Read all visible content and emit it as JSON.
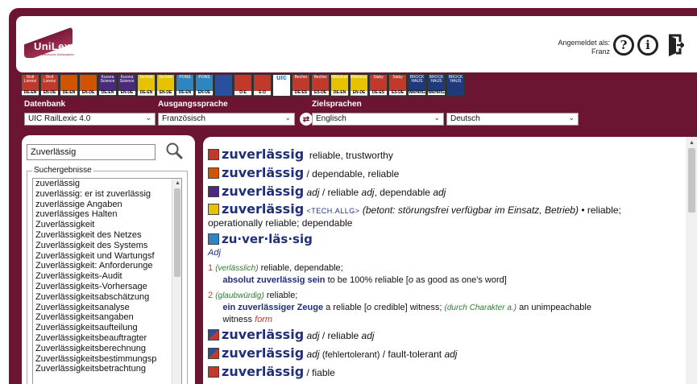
{
  "header": {
    "logo_name": "UniLex",
    "logo_sub": "Electronic Dictionaries",
    "login_label": "Angemeldet als:",
    "login_user": "Franz"
  },
  "dictionaries": [
    {
      "top": "Dictl Lorenz",
      "bot": "DE-EN",
      "color": "#c0392b"
    },
    {
      "top": "Dictl Lorenz",
      "bot": "EN-DE",
      "color": "#c0392b"
    },
    {
      "top": "",
      "bot": "DE-EN",
      "color": "#d35400"
    },
    {
      "top": "",
      "bot": "EN-DE",
      "color": "#d35400"
    },
    {
      "top": "Kucera Science",
      "bot": "DE-EN",
      "color": "#4a2a7a"
    },
    {
      "top": "Kucera Science",
      "bot": "EN-DE",
      "color": "#4a2a7a"
    },
    {
      "top": "Technik",
      "bot": "DE-EN",
      "color": "#e6c200"
    },
    {
      "top": "Technik",
      "bot": "EN-DE",
      "color": "#e6c200"
    },
    {
      "top": "PONS",
      "bot": "DE-EN",
      "color": "#2e86c1"
    },
    {
      "top": "PONS",
      "bot": "EN-DE",
      "color": "#2e86c1"
    },
    {
      "top": "",
      "bot": "",
      "color": "#2a4fa0"
    },
    {
      "top": "",
      "bot": "D-E",
      "color": "#c0392b"
    },
    {
      "top": "",
      "bot": "E-D",
      "color": "#c0392b"
    },
    {
      "top": "uic",
      "bot": "",
      "color": "#ffffff"
    },
    {
      "top": "Becher",
      "bot": "DE-ES",
      "color": "#c0392b"
    },
    {
      "top": "Becher",
      "bot": "ES-DE",
      "color": "#c0392b"
    },
    {
      "top": "Mittelsud.",
      "bot": "DE-EN",
      "color": "#e6c200"
    },
    {
      "top": "Mittelsud.",
      "bot": "EN-DE",
      "color": "#e6c200"
    },
    {
      "top": "Slaby",
      "bot": "DE-ES",
      "color": "#c0392b"
    },
    {
      "top": "Slaby",
      "bot": "ES-DE",
      "color": "#c0392b"
    },
    {
      "top": "BROCK HAUS",
      "bot": "WAHRIG",
      "color": "#1f3a7a"
    },
    {
      "top": "BROCK HAUS",
      "bot": "WAHRIG",
      "color": "#1f3a7a"
    },
    {
      "top": "BROCK HAUS",
      "bot": "",
      "color": "#1f3a7a"
    }
  ],
  "labels": {
    "datenbank": "Datenbank",
    "ausgangssprache": "Ausgangssprache",
    "zielsprachen": "Zielsprachen"
  },
  "selects": {
    "datenbank": "UIC RailLexic 4.0",
    "ausgangssprache": "Französisch",
    "ziel1": "Englisch",
    "ziel2": "Deutsch"
  },
  "search": {
    "value": "Zuverlässig",
    "results_legend": "Suchergebnisse",
    "results": [
      "zuverlässig",
      "zuverlässig: er ist zuverlässig",
      "zuverlässige Angaben",
      "zuverlässiges Halten",
      "Zuverlässigkeit",
      "Zuverlässigkeit des Netzes",
      "Zuverlässigkeit des Systems",
      "Zuverlässigkeit und Wartungsf",
      "Zuverlässigkeit: Anforderunge",
      "Zuverlässigkeits-Audit",
      "Zuverlässigkeits-Vorhersage",
      "Zuverlässigkeitsabschätzung",
      "Zuverlässigkeitsanalyse",
      "Zuverlässigkeitsangaben",
      "Zuverlässigkeitsaufteilung",
      "Zuverlässigkeitsbeauftragter",
      "Zuverlässigkeitsberechnung",
      "Zuverlässigkeitsbestimmungsp",
      "Zuverlässigkeitsbetrachtung"
    ]
  },
  "entries": {
    "e1_hw": "zuverlässig",
    "e1_tr": "reliable, trustworthy",
    "e2_hw": "zuverlässig",
    "e2_tr": "/ dependable, reliable",
    "e3_hw": "zuverlässig",
    "e3_pos": "adj",
    "e3_tr1": "/ reliable",
    "e3_adj1": "adj",
    "e3_tr2": ", dependable",
    "e3_adj2": "adj",
    "e4_hw": "zuverlässig",
    "e4_tag": "<TECH.ALLG>",
    "e4_note": "(betont: störungsfrei verfügbar im Einsatz, Betrieb)",
    "e4_tr": "• reliable; operationally reliable; dependable",
    "e5_hw": "zu·ver·läs·sig",
    "e5_pos": "Adj",
    "e5_s1_num": "1",
    "e5_s1_gloss": "(verlässlich)",
    "e5_s1_tr": "reliable, dependable;",
    "e5_s1_ex": "absolut zuverlässig sein",
    "e5_s1_ex_tr": "to be 100% reliable [",
    "e5_s1_o": "o",
    "e5_s1_rest": "as good as one's word]",
    "e5_s2_num": "2",
    "e5_s2_gloss": "(glaubwürdig)",
    "e5_s2_tr": "reliable;",
    "e5_s2_ex": "ein zuverlässiger Zeuge",
    "e5_s2_ex_tr": "a reliable [",
    "e5_s2_o": "o",
    "e5_s2_rest": "credible] witness;",
    "e5_s2_gloss2": "(durch Charakter a.)",
    "e5_s2_tr2": "an unimpeachable",
    "e5_s2_tr3": "witness",
    "e5_s2_form": "form",
    "e6_hw": "zuverlässig",
    "e6_pos": "adj",
    "e6_tr": "/ reliable",
    "e6_adj": "adj",
    "e7_hw": "zuverlässig",
    "e7_pos": "adj",
    "e7_note": "(fehlertolerant)",
    "e7_tr": "/ fault-tolerant",
    "e7_adj": "adj",
    "e8_hw": "zuverlässig",
    "e8_tr": "/ fiable"
  }
}
